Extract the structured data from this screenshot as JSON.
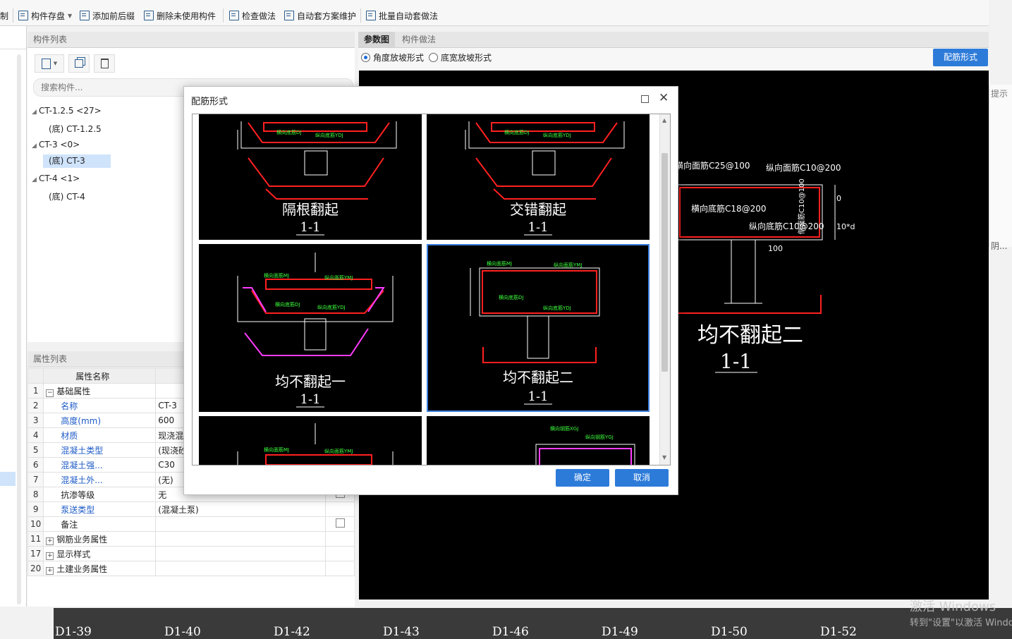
{
  "toolbar": {
    "items": [
      {
        "label": "复制",
        "icon": "copy-icon"
      },
      {
        "label": "构件存盘",
        "icon": "save-icon"
      },
      {
        "label": "添加前后缀",
        "icon": "prefix-icon"
      },
      {
        "label": "删除未使用构件",
        "icon": "delete-unused-icon"
      },
      {
        "label": "检查做法",
        "icon": "check-icon"
      },
      {
        "label": "自动套方案维护",
        "icon": "auto-scheme-icon"
      },
      {
        "label": "批量自动套做法",
        "icon": "batch-icon"
      }
    ]
  },
  "component_panel": {
    "title": "构件列表",
    "search_placeholder": "搜索构件...",
    "tree": [
      {
        "label": "CT-1.2.5 <27>",
        "children": [
          "(底) CT-1.2.5"
        ]
      },
      {
        "label": "CT-3 <0>",
        "children": [
          "(底) CT-3"
        ]
      },
      {
        "label": "CT-4 <1>",
        "children": [
          "(底) CT-4"
        ]
      }
    ]
  },
  "property_panel": {
    "title": "属性列表",
    "header": "属性名称",
    "rows": [
      {
        "num": "1",
        "name": "基础属性",
        "value": "",
        "group": true
      },
      {
        "num": "2",
        "name": "名称",
        "value": "CT-3",
        "link": true
      },
      {
        "num": "3",
        "name": "高度(mm)",
        "value": "600",
        "link": true
      },
      {
        "num": "4",
        "name": "材质",
        "value": "现浇混凝土",
        "link": true
      },
      {
        "num": "5",
        "name": "混凝土类型",
        "value": "(现浇砼)",
        "link": true
      },
      {
        "num": "6",
        "name": "混凝土强...",
        "value": "C30",
        "link": true
      },
      {
        "num": "7",
        "name": "混凝土外...",
        "value": "(无)",
        "link": true
      },
      {
        "num": "8",
        "name": "抗渗等级",
        "value": "无",
        "link": false,
        "check": true
      },
      {
        "num": "9",
        "name": "泵送类型",
        "value": "(混凝土泵)",
        "link": true
      },
      {
        "num": "10",
        "name": "备注",
        "value": "",
        "link": false,
        "check": true
      },
      {
        "num": "11",
        "name": "钢筋业务属性",
        "value": "",
        "group": true
      },
      {
        "num": "17",
        "name": "显示样式",
        "value": "",
        "group": true
      },
      {
        "num": "20",
        "name": "土建业务属性",
        "value": "",
        "group": true
      }
    ]
  },
  "right_panel": {
    "tabs": [
      "参数图",
      "构件做法"
    ],
    "radio_angle": "角度放坡形式",
    "radio_width": "底宽放坡形式",
    "config_button": "配筋形式",
    "side_text_1": "提示",
    "side_text_2": "阴...",
    "drawing": {
      "label_top_h": "横向面筋C25@100",
      "label_top_v": "纵向面筋C10@200",
      "label_bot_h": "横向底筋C18@200",
      "label_bot_v": "纵向底筋C10@200",
      "label_side": "侧面筋C10@100",
      "dim_0": "0",
      "dim_1": "10*d",
      "dim_2": "100",
      "title": "均不翻起二",
      "section": "1-1"
    }
  },
  "dialog": {
    "title": "配筋形式",
    "confirm": "确定",
    "cancel": "取消",
    "options": [
      {
        "name": "隔根翻起",
        "section": "1-1"
      },
      {
        "name": "交错翻起",
        "section": "1-1"
      },
      {
        "name": "均不翻起一",
        "section": "1-1"
      },
      {
        "name": "均不翻起二",
        "section": "1-1"
      }
    ],
    "thumb_labels": {
      "h_top": "横向面筋MJ",
      "v_top": "纵向面筋YMJ",
      "h_bot": "横向底筋DJ",
      "v_bot": "纵向底筋YDJ",
      "h_bar": "横向钢筋XGJ",
      "v_bar": "纵向钢筋YGJ"
    },
    "selected_index": 3
  },
  "bottom_strip": {
    "labels": [
      "D1-39",
      "D1-40",
      "D1-42",
      "D1-43",
      "D1-46",
      "D1-49",
      "D1-50",
      "D1-52"
    ],
    "watermark_1": "激活 Windows",
    "watermark_2": "转到\"设置\"以激活 Windows"
  },
  "colors": {
    "accent": "#2d7bd9",
    "rebar_red": "#ff2020",
    "rebar_magenta": "#ff3cff",
    "label_green": "#3cff3c"
  }
}
